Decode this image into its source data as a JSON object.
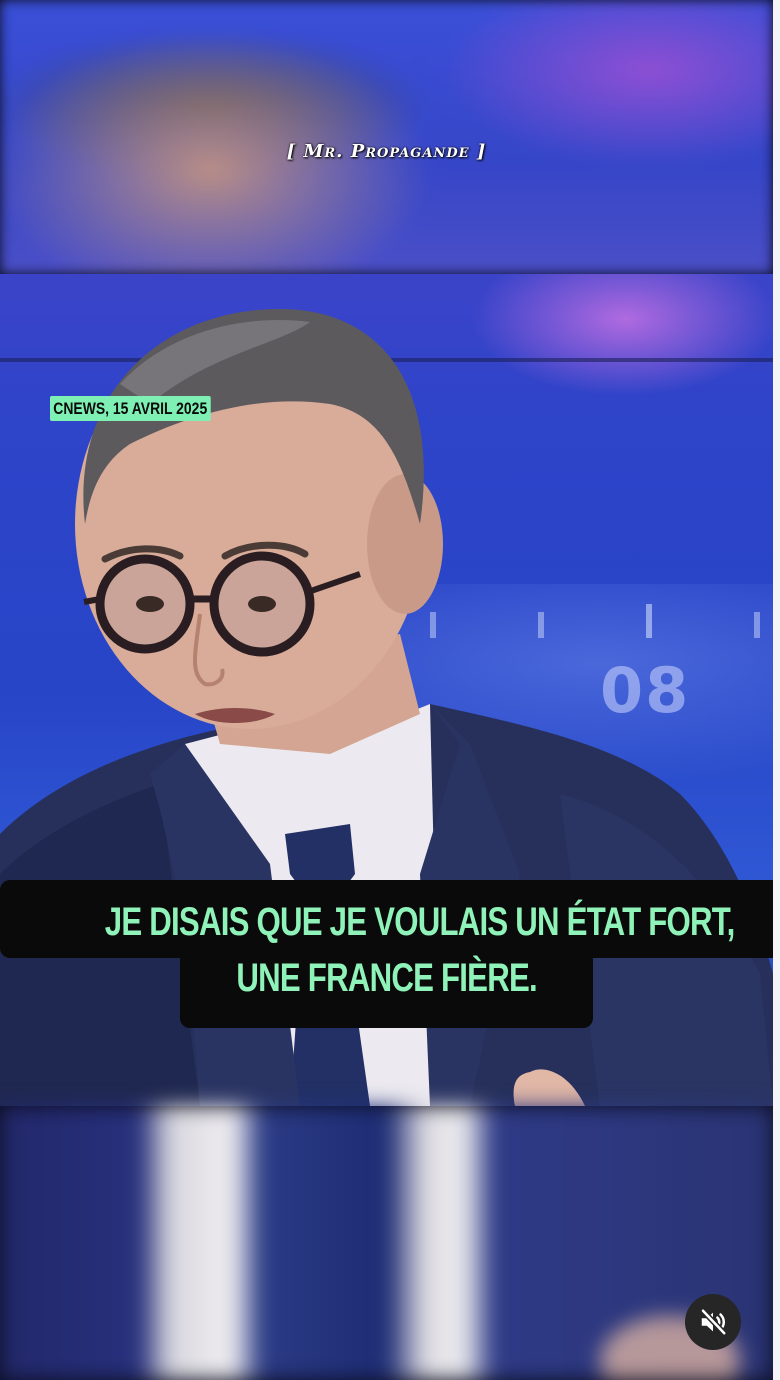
{
  "watermark": {
    "text": "[ Mr. Propagande ]"
  },
  "video": {
    "source_label": "CNEWS, 15 AVRIL 2025",
    "studio_number": "08",
    "subtitle": {
      "line1": "JE DISAIS QUE JE VOULAIS UN ÉTAT FORT,",
      "line2": "UNE FRANCE FIÈRE."
    }
  },
  "controls": {
    "mute_icon": "speaker-muted-icon",
    "muted": true
  },
  "colors": {
    "subtitle_text": "#8ff2b8",
    "label_background": "#7ef0b4",
    "studio_blue": "#2745c7"
  }
}
